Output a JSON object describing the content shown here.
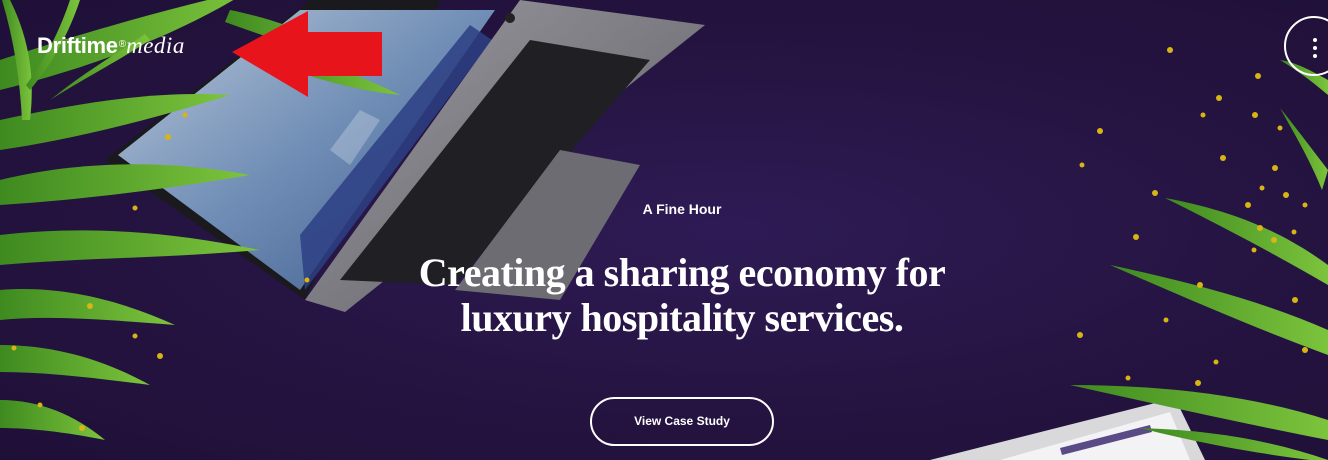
{
  "logo": {
    "brand": "Driftime",
    "registered_mark": "®",
    "suffix": "media"
  },
  "menu": {
    "icon": "kebab-menu-icon"
  },
  "hero": {
    "eyebrow": "A Fine Hour",
    "headline_line1": "Creating a sharing economy for",
    "headline_line2": "luxury hospitality services.",
    "cta_label": "View Case Study"
  },
  "colors": {
    "background": "#261546",
    "text": "#ffffff",
    "annotation_arrow": "#e8141c",
    "leaf_green": "#4f9a2a",
    "pellet_yellow": "#d8b415"
  }
}
